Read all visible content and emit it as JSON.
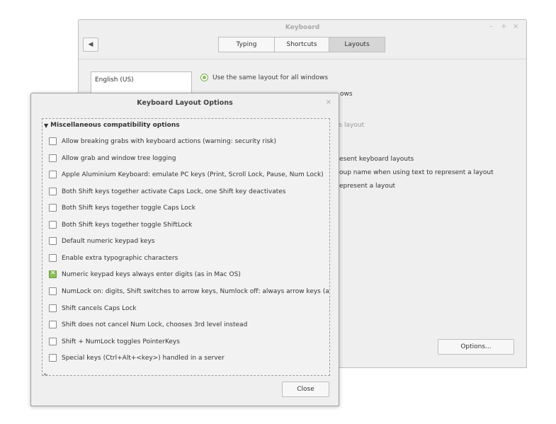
{
  "keyboard_window": {
    "title": "Keyboard",
    "controls": {
      "minimize": "–",
      "maximize": "+",
      "close": "×"
    },
    "back_icon": "left-arrow-icon",
    "tabs": [
      {
        "label": "Typing",
        "active": false
      },
      {
        "label": "Shortcuts",
        "active": false
      },
      {
        "label": "Layouts",
        "active": true
      }
    ],
    "layout_list": [
      "English (US)"
    ],
    "radio_same_layout": "Use the same layout for all windows",
    "radio_different_layout_fragment": "ows",
    "layout_fragment": "'s layout",
    "text_fragments": [
      "esent keyboard layouts",
      "oup name when using text to represent a layout",
      "epresent a layout"
    ],
    "options_button": "Options..."
  },
  "dialog": {
    "title": "Keyboard Layout Options",
    "close_x": "×",
    "group_header": "Miscellaneous compatibility options",
    "options": [
      {
        "label": "Allow breaking grabs with keyboard actions (warning: security risk)",
        "checked": false
      },
      {
        "label": "Allow grab and window tree logging",
        "checked": false
      },
      {
        "label": "Apple Aluminium Keyboard: emulate PC keys (Print, Scroll Lock, Pause, Num Lock)",
        "checked": false
      },
      {
        "label": "Both Shift keys together activate Caps Lock, one Shift key deactivates",
        "checked": false
      },
      {
        "label": "Both Shift keys together toggle Caps Lock",
        "checked": false
      },
      {
        "label": "Both Shift keys together toggle ShiftLock",
        "checked": false
      },
      {
        "label": "Default numeric keypad keys",
        "checked": false
      },
      {
        "label": "Enable extra typographic characters",
        "checked": false
      },
      {
        "label": "Numeric keypad keys always enter digits (as in Mac OS)",
        "checked": true
      },
      {
        "label": "NumLock on: digits, Shift switches to arrow keys, Numlock off: always arrow keys (as in",
        "checked": false
      },
      {
        "label": "Shift cancels Caps Lock",
        "checked": false
      },
      {
        "label": "Shift does not cancel Num Lock, chooses 3rd level instead",
        "checked": false
      },
      {
        "label": "Shift + NumLock toggles PointerKeys",
        "checked": false
      },
      {
        "label": "Special keys (Ctrl+Alt+<key>) handled in a server",
        "checked": false
      }
    ],
    "close_button": "Close"
  },
  "colors": {
    "accent_green": "#8cbd5b",
    "window_bg": "#efefef",
    "border": "#bdbdbd"
  }
}
